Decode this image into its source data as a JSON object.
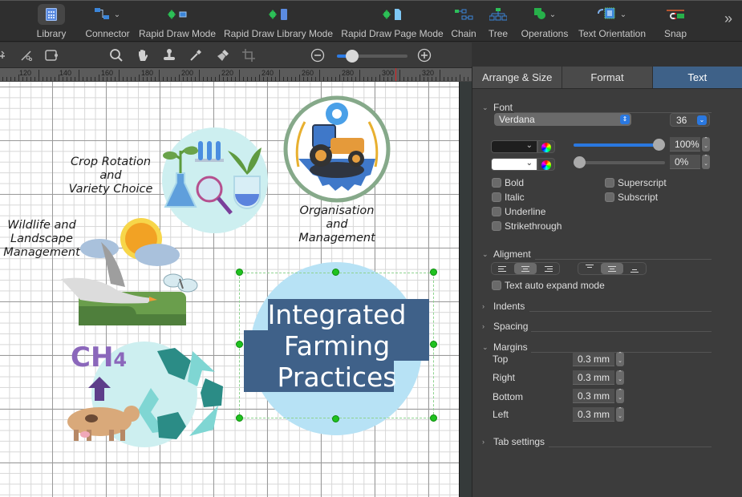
{
  "toolbar": {
    "items": [
      {
        "label": "Library",
        "icon": "library-icon",
        "active": true
      },
      {
        "label": "Connector",
        "icon": "connector-icon",
        "has_menu": true
      },
      {
        "label": "Rapid Draw Mode",
        "icon": "rapid-draw-icon"
      },
      {
        "label": "Rapid Draw Library Mode",
        "icon": "rapid-draw-library-icon"
      },
      {
        "label": "Rapid Draw Page Mode",
        "icon": "rapid-draw-page-icon"
      },
      {
        "label": "Chain",
        "icon": "chain-icon"
      },
      {
        "label": "Tree",
        "icon": "tree-icon"
      },
      {
        "label": "Operations",
        "icon": "operations-icon",
        "has_menu": true
      },
      {
        "label": "Text Orientation",
        "icon": "text-orientation-icon",
        "has_menu": true
      },
      {
        "label": "Snap",
        "icon": "snap-magnet-icon"
      }
    ],
    "more": "»"
  },
  "toolbar2": {
    "tools": [
      "connection-point-icon",
      "format-painter-cut-icon",
      "shape-edit-icon",
      "search-icon",
      "hand-pan-icon",
      "stamp-icon",
      "eyedropper-icon",
      "brush-icon",
      "crop-icon"
    ],
    "zoom_out": "−",
    "zoom_in": "+",
    "zoom_level": 0.15
  },
  "ruler": {
    "labels": [
      "120",
      "140",
      "160",
      "180",
      "200",
      "220",
      "240",
      "260",
      "280",
      "300",
      "320"
    ]
  },
  "canvas": {
    "labels": {
      "crop_rotation": [
        "Crop Rotation",
        "and",
        "Variety Choice"
      ],
      "wildlife": [
        "Wildlife and",
        "Landscape",
        "Management"
      ],
      "organisation": [
        "Organisation",
        "and",
        "Management"
      ]
    },
    "title_lines": [
      "Integrated",
      "Farming",
      "Practices"
    ],
    "ch4_label": "CH",
    "ch4_sub": "4"
  },
  "panel": {
    "tabs": [
      {
        "label": "Arrange & Size",
        "active": false
      },
      {
        "label": "Format",
        "active": false
      },
      {
        "label": "Text",
        "active": true
      }
    ],
    "font": {
      "section": "Font",
      "family": "Verdana",
      "size": "36",
      "text_color": "#1e1e1e",
      "bg_color": "#ffffff",
      "opacity": "100%",
      "opacity_value": 1.0,
      "bg_opacity": "0%",
      "bg_opacity_value": 0.0,
      "checkboxes_left": [
        "Bold",
        "Italic",
        "Underline",
        "Strikethrough"
      ],
      "checkboxes_right": [
        "Superscript",
        "Subscript"
      ]
    },
    "alignment": {
      "section": "Aligment",
      "horizontal": [
        "left",
        "center",
        "right"
      ],
      "horizontal_selected": "center",
      "vertical": [
        "top",
        "middle",
        "bottom"
      ],
      "vertical_selected": "middle",
      "auto_expand": "Text auto expand mode"
    },
    "indents": "Indents",
    "spacing": "Spacing",
    "margins": {
      "section": "Margins",
      "rows": [
        {
          "label": "Top",
          "value": "0.3 mm"
        },
        {
          "label": "Right",
          "value": "0.3 mm"
        },
        {
          "label": "Bottom",
          "value": "0.3 mm"
        },
        {
          "label": "Left",
          "value": "0.3 mm"
        }
      ]
    },
    "tab_settings": "Tab settings"
  }
}
